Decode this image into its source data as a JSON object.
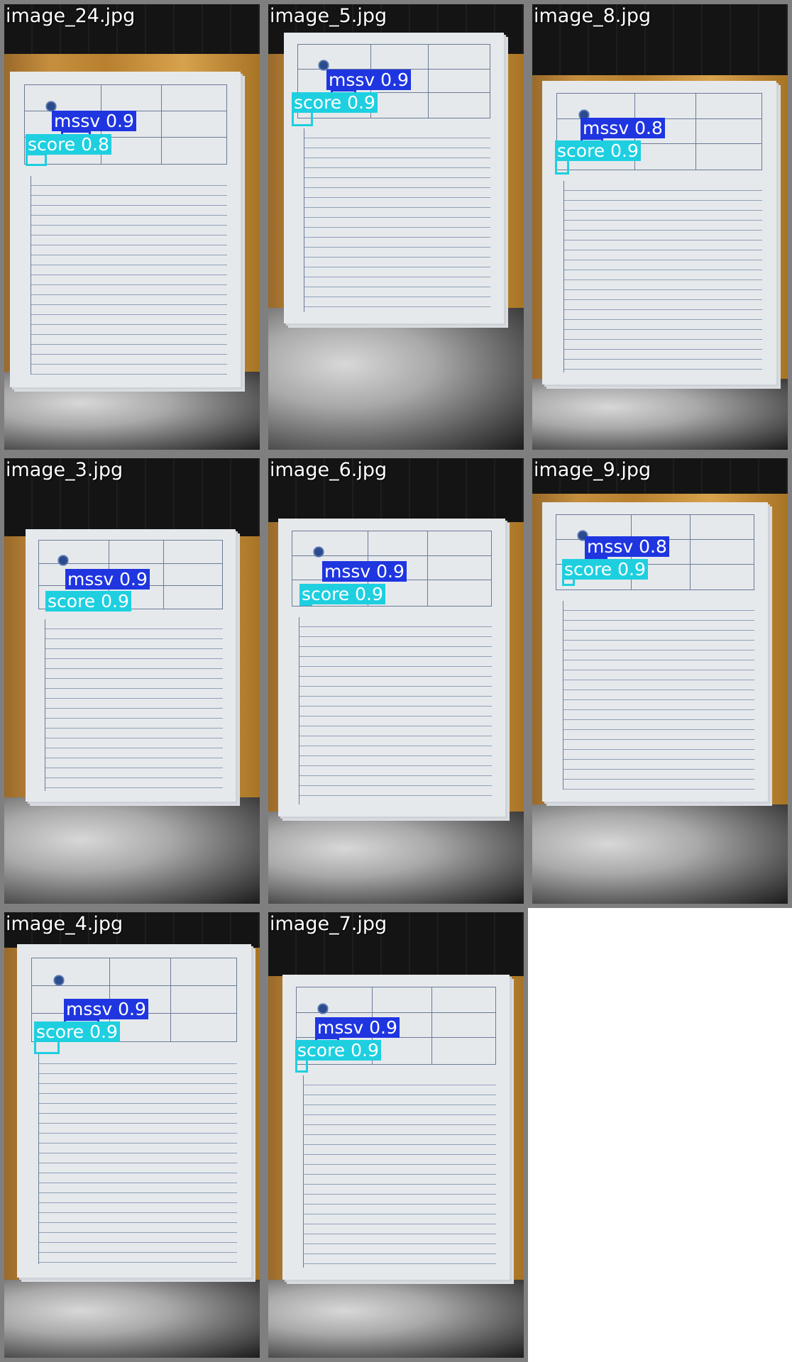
{
  "colors": {
    "tile_border": "#7f7f7f",
    "mssv_label_bg": "#1f35e0",
    "score_label_bg": "#1ecfe0",
    "label_text": "#ffffff"
  },
  "tiles": [
    {
      "filename": "image_24.jpg",
      "detections": [
        {
          "class": "mssv",
          "confidence_text": "0.9"
        },
        {
          "class": "score",
          "confidence_text": "0.8"
        }
      ]
    },
    {
      "filename": "image_5.jpg",
      "detections": [
        {
          "class": "mssv",
          "confidence_text": "0.9"
        },
        {
          "class": "score",
          "confidence_text": "0.9"
        }
      ]
    },
    {
      "filename": "image_8.jpg",
      "detections": [
        {
          "class": "mssv",
          "confidence_text": "0.8"
        },
        {
          "class": "score",
          "confidence_text": "0.9"
        }
      ]
    },
    {
      "filename": "image_3.jpg",
      "detections": [
        {
          "class": "mssv",
          "confidence_text": "0.9"
        },
        {
          "class": "score",
          "confidence_text": "0.9"
        }
      ]
    },
    {
      "filename": "image_6.jpg",
      "detections": [
        {
          "class": "mssv",
          "confidence_text": "0.9"
        },
        {
          "class": "score",
          "confidence_text": "0.9"
        }
      ]
    },
    {
      "filename": "image_9.jpg",
      "detections": [
        {
          "class": "mssv",
          "confidence_text": "0.8"
        },
        {
          "class": "score",
          "confidence_text": "0.9"
        }
      ]
    },
    {
      "filename": "image_4.jpg",
      "detections": [
        {
          "class": "mssv",
          "confidence_text": "0.9"
        },
        {
          "class": "score",
          "confidence_text": "0.9"
        }
      ]
    },
    {
      "filename": "image_7.jpg",
      "detections": [
        {
          "class": "mssv",
          "confidence_text": "0.9"
        },
        {
          "class": "score",
          "confidence_text": "0.9"
        }
      ]
    }
  ],
  "labels": {
    "t0_mssv": "mssv 0.9",
    "t0_score": "score 0.8",
    "t1_mssv": "mssv 0.9",
    "t1_score": "score 0.9",
    "t2_mssv": "mssv 0.8",
    "t2_score": "score 0.9",
    "t3_mssv": "mssv 0.9",
    "t3_score": "score 0.9",
    "t4_mssv": "mssv 0.9",
    "t4_score": "score 0.9",
    "t5_mssv": "mssv 0.8",
    "t5_score": "score 0.9",
    "t6_mssv": "mssv 0.9",
    "t6_score": "score 0.9",
    "t7_mssv": "mssv 0.9",
    "t7_score": "score 0.9"
  }
}
